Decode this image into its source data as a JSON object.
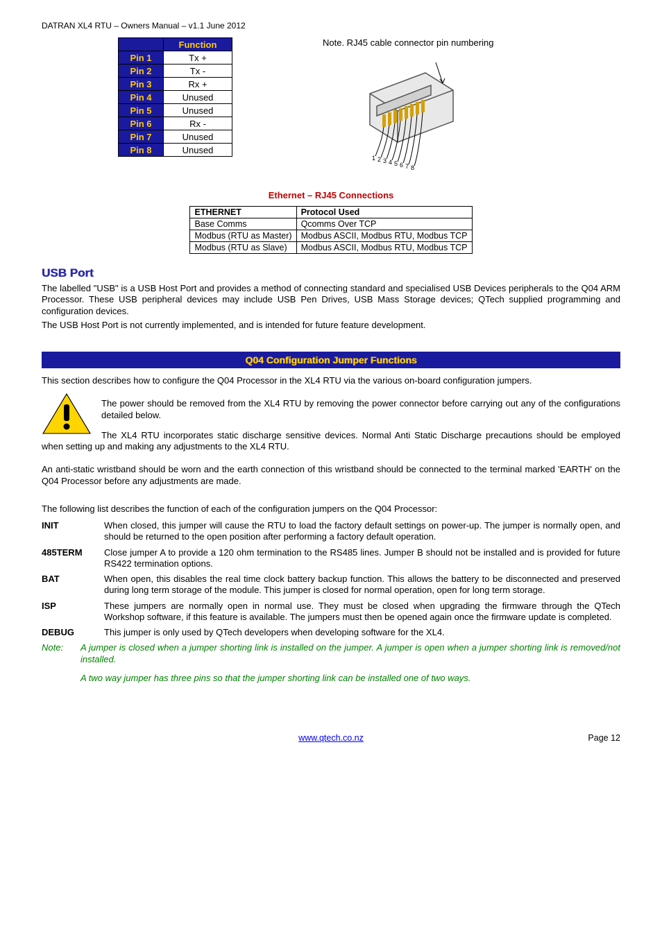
{
  "doc_header": "DATRAN XL4 RTU – Owners Manual – v1.1 June 2012",
  "pin_table": {
    "func_header": "Function",
    "rows": [
      {
        "pin": "Pin 1",
        "func": "Tx +"
      },
      {
        "pin": "Pin 2",
        "func": "Tx -"
      },
      {
        "pin": "Pin 3",
        "func": "Rx +"
      },
      {
        "pin": "Pin 4",
        "func": "Unused"
      },
      {
        "pin": "Pin 5",
        "func": "Unused"
      },
      {
        "pin": "Pin 6",
        "func": "Rx -"
      },
      {
        "pin": "Pin 7",
        "func": "Unused"
      },
      {
        "pin": "Pin 8",
        "func": "Unused"
      }
    ]
  },
  "rj45_note": "Note. RJ45 cable connector pin numbering",
  "eth_heading": "Ethernet – RJ45 Connections",
  "eth_table": {
    "headers": [
      "ETHERNET",
      "Protocol Used"
    ],
    "rows": [
      [
        "Base Comms",
        "Qcomms Over TCP"
      ],
      [
        "Modbus (RTU as Master)",
        "Modbus ASCII, Modbus RTU, Modbus TCP"
      ],
      [
        "Modbus (RTU as Slave)",
        "Modbus ASCII, Modbus RTU, Modbus TCP"
      ]
    ]
  },
  "usb": {
    "heading": "USB Port",
    "p1": "The labelled \"USB\" is a USB Host Port and provides a method of connecting standard and specialised USB Devices peripherals to the Q04 ARM Processor.  These USB peripheral devices may include USB Pen Drives, USB Mass Storage devices; QTech supplied programming and configuration devices.",
    "p2": "The USB Host Port is not currently implemented, and is intended for future feature development."
  },
  "q04": {
    "bar": "Q04 Configuration Jumper Functions",
    "intro": "This section describes how to configure the Q04 Processor in the XL4 RTU via the various on-board configuration jumpers.",
    "warn1": "The power should be removed from the XL4 RTU by removing the power connector before carrying out any of the configurations detailed below.",
    "warn2": "The XL4 RTU incorporates static discharge sensitive devices.  Normal Anti Static Discharge precautions should be employed when setting up and making any adjustments to the XL4 RTU.",
    "warn3": "An anti-static wristband should be worn and the earth connection of this wristband should be connected to the terminal marked 'EARTH' on the Q04 Processor before any adjustments are made.",
    "list_intro": "The following list describes the function of each of the configuration jumpers on the Q04 Processor:",
    "items": [
      {
        "label": "INIT",
        "desc": "When closed, this jumper will cause the RTU to load the factory default settings on power-up. The jumper is normally open, and should be returned to the open position after performing a factory default operation."
      },
      {
        "label": "485TERM",
        "desc": "Close jumper A to provide a 120 ohm termination to the RS485 lines. Jumper B should not be installed and is provided for future RS422 termination options."
      },
      {
        "label": "BAT",
        "desc": "When open, this disables the real time clock battery backup function.  This allows the battery to be disconnected and preserved during long term storage of the module. This jumper is closed for normal operation, open for long term storage."
      },
      {
        "label": "ISP",
        "desc": "These jumpers are normally open in normal use. They must be closed when upgrading the firmware through the QTech Workshop software, if this feature is available. The jumpers must then be opened again once the firmware update is completed."
      },
      {
        "label": "DEBUG",
        "desc": "This jumper is only used by QTech developers when developing software for the XL4."
      }
    ],
    "note_label": "Note:",
    "note1": "A jumper is closed when a jumper shorting link is installed on the jumper.  A jumper is open when a jumper shorting link is removed/not installed.",
    "note2": "A two way jumper has three pins so that the jumper shorting link can be installed one of two ways."
  },
  "footer": {
    "link": "www.qtech.co.nz",
    "page": "Page 12"
  }
}
